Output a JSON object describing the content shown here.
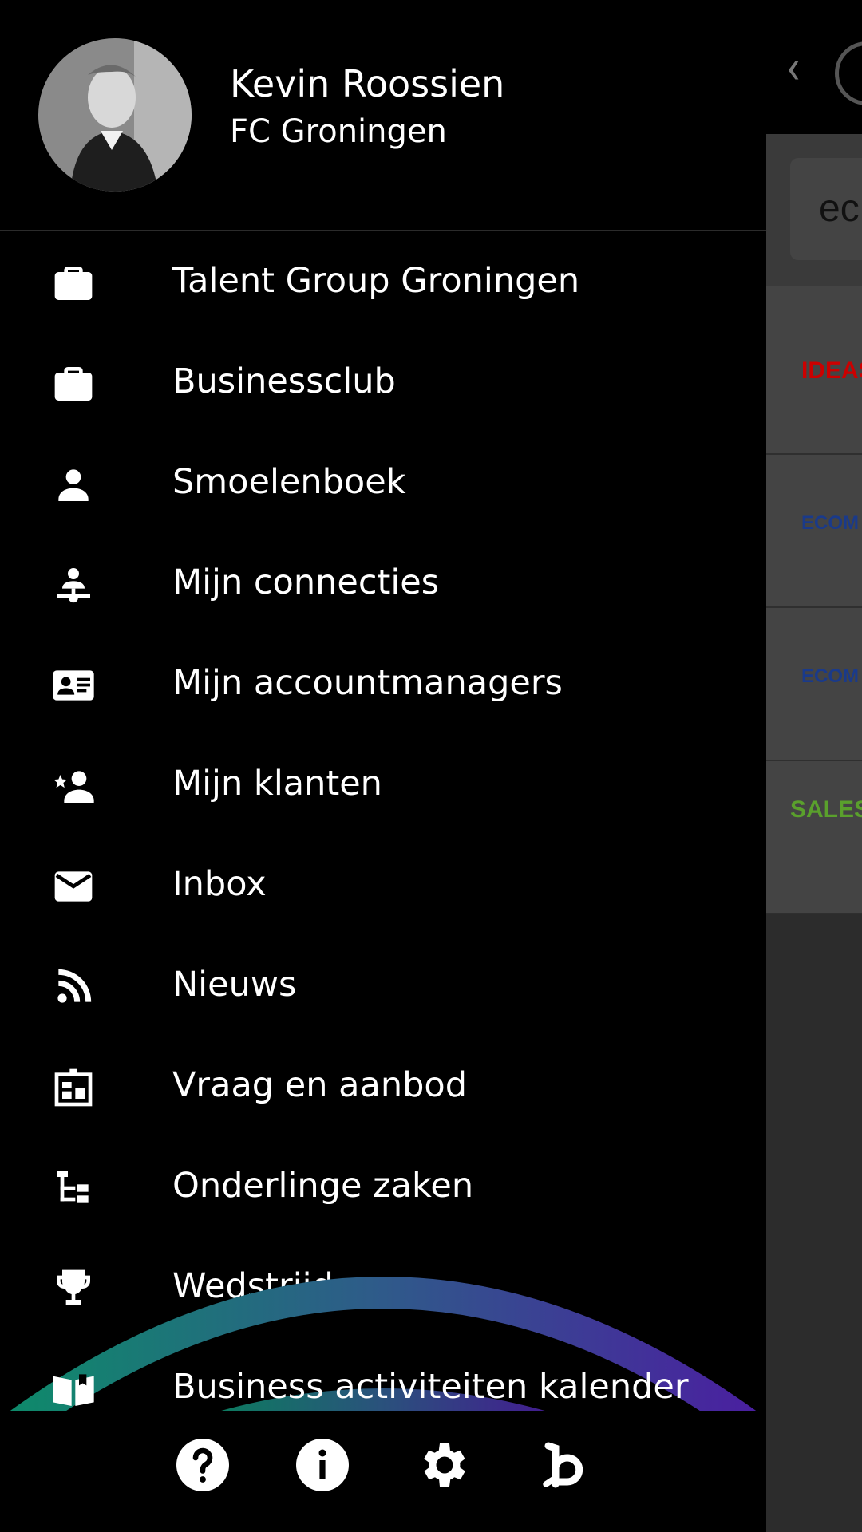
{
  "profile": {
    "name": "Kevin Roossien",
    "organization": "FC Groningen"
  },
  "menu": [
    {
      "label": "Talent Group Groningen",
      "icon": "briefcase-icon"
    },
    {
      "label": "Businessclub",
      "icon": "briefcase-icon"
    },
    {
      "label": "Smoelenboek",
      "icon": "person-icon"
    },
    {
      "label": "Mijn connecties",
      "icon": "network-person-icon"
    },
    {
      "label": "Mijn accountmanagers",
      "icon": "contact-card-icon"
    },
    {
      "label": "Mijn klanten",
      "icon": "starred-person-icon"
    },
    {
      "label": "Inbox",
      "icon": "mail-icon"
    },
    {
      "label": "Nieuws",
      "icon": "rss-feed-icon"
    },
    {
      "label": "Vraag en aanbod",
      "icon": "market-board-icon"
    },
    {
      "label": "Onderlinge zaken",
      "icon": "tree-structure-icon"
    },
    {
      "label": "Wedstrijden",
      "icon": "trophy-icon"
    },
    {
      "label": "Business activiteiten kalender",
      "icon": "open-book-icon"
    }
  ],
  "bottom_bar": [
    {
      "icon": "help-icon"
    },
    {
      "icon": "info-icon"
    },
    {
      "icon": "settings-icon"
    },
    {
      "icon": "brand-b-icon"
    }
  ],
  "background": {
    "search_text": "ec",
    "cards": [
      "IDEAS",
      "ECOM",
      "ECOM",
      "SALES"
    ]
  },
  "colors": {
    "drawer_bg": "#000000",
    "text": "#ffffff",
    "arc_start": "#0e8a6a",
    "arc_mid": "#2f5a8a",
    "arc_end": "#4a1fa0"
  }
}
